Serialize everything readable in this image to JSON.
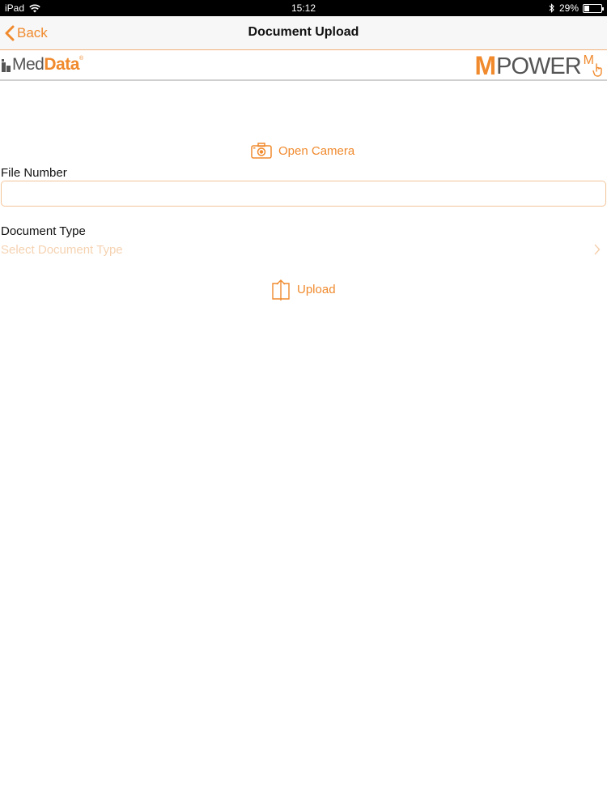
{
  "status_bar": {
    "device": "iPad",
    "time": "15:12",
    "battery_percent": "29%",
    "battery_level": 0.29
  },
  "nav": {
    "back_label": "Back",
    "title": "Document Upload"
  },
  "logos": {
    "meddata_med": "Med",
    "meddata_data": "Data",
    "meddata_reg": "®",
    "mpower_m": "M",
    "mpower_text": "POWER",
    "mpower_mark": "M"
  },
  "actions": {
    "open_camera_label": "Open Camera",
    "upload_label": "Upload"
  },
  "form": {
    "file_number_label": "File Number",
    "file_number_value": "",
    "document_type_label": "Document Type",
    "document_type_placeholder": "Select Document Type"
  },
  "colors": {
    "accent": "#f08a2d",
    "placeholder": "#f5d2b1",
    "input_border": "#f3c49a"
  }
}
